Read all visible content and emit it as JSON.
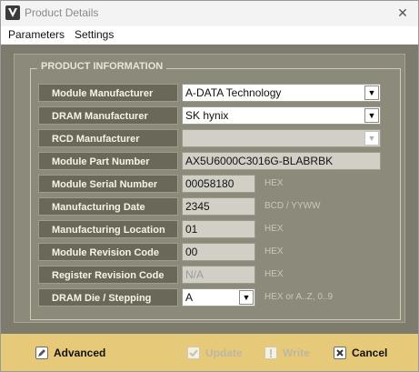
{
  "window": {
    "title": "Product Details"
  },
  "menubar": {
    "items": [
      "Parameters",
      "Settings"
    ]
  },
  "panel": {
    "group_title": "PRODUCT INFORMATION",
    "rows": [
      {
        "label": "Module Manufacturer",
        "value": "A-DATA Technology",
        "hint": ""
      },
      {
        "label": "DRAM Manufacturer",
        "value": "SK hynix",
        "hint": ""
      },
      {
        "label": "RCD Manufacturer",
        "value": "",
        "hint": ""
      },
      {
        "label": "Module Part Number",
        "value": "AX5U6000C3016G-BLABRBK",
        "hint": ""
      },
      {
        "label": "Module Serial Number",
        "value": "00058180",
        "hint": "HEX"
      },
      {
        "label": "Manufacturing Date",
        "value": "2345",
        "hint": "BCD / YYWW"
      },
      {
        "label": "Manufacturing Location",
        "value": "01",
        "hint": "HEX"
      },
      {
        "label": "Module Revision Code",
        "value": "00",
        "hint": "HEX"
      },
      {
        "label": "Register Revision Code",
        "value": "N/A",
        "hint": "HEX"
      },
      {
        "label": "DRAM Die / Stepping",
        "value": "A",
        "hint": "HEX or A..Z, 0..9"
      }
    ]
  },
  "footer": {
    "advanced": "Advanced",
    "update": "Update",
    "write": "Write",
    "cancel": "Cancel"
  },
  "colors": {
    "panel_bg": "#7d7b6d",
    "footer_bg": "#e7ca79",
    "label_bg": "#6a6859"
  }
}
